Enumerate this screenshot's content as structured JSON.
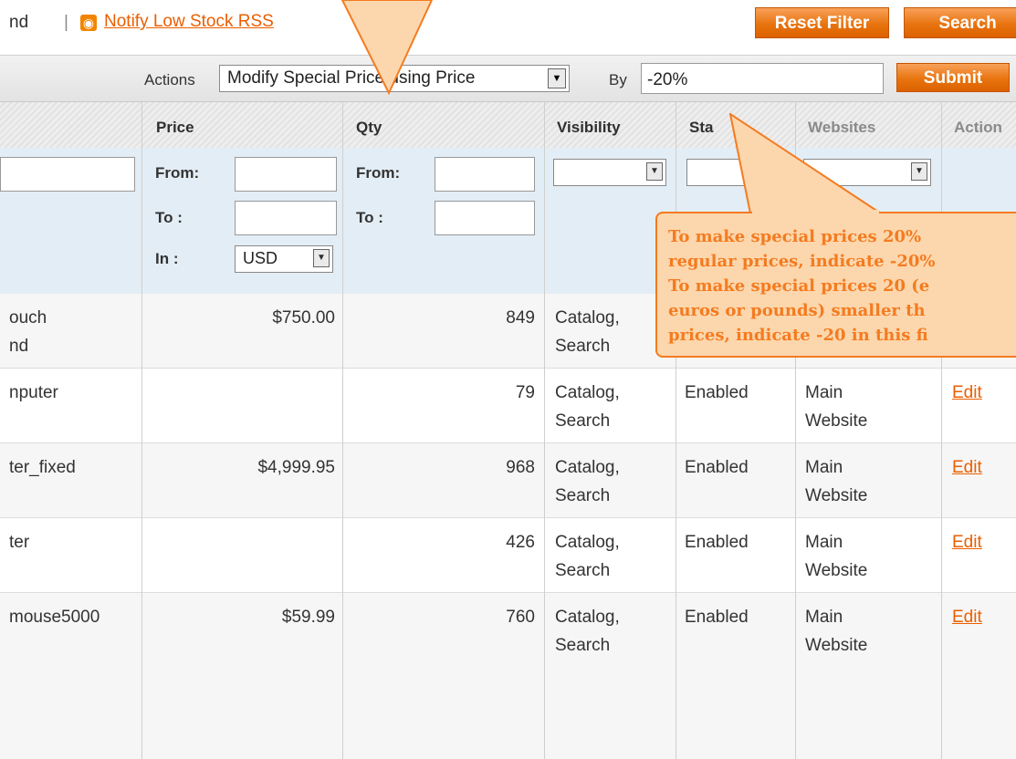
{
  "topbar": {
    "lead_text": "nd",
    "separator": "|",
    "rss_icon": "rss-icon",
    "rss_link": "Notify Low Stock RSS",
    "reset_filter": "Reset Filter",
    "search": "Search"
  },
  "massaction": {
    "actions_label": "Actions",
    "selected_action": "Modify Special Price using Price",
    "by_label": "By",
    "by_value": "-20%",
    "submit": "Submit"
  },
  "columns": {
    "price": "Price",
    "qty": "Qty",
    "visibility": "Visibility",
    "status": "Sta",
    "websites": "Websites",
    "action": "Action"
  },
  "filters": {
    "price_from": "From:",
    "price_to": "To :",
    "price_in": "In :",
    "currency": "USD",
    "qty_from": "From:",
    "qty_to": "To :"
  },
  "rows": [
    {
      "name": [
        "ouch",
        "nd"
      ],
      "price": "$750.00",
      "qty": "849",
      "visibility": [
        "Catalog,",
        "Search"
      ],
      "status": "",
      "website": [
        "",
        ""
      ],
      "action": ""
    },
    {
      "name": [
        "nputer",
        ""
      ],
      "price": "",
      "qty": "79",
      "visibility": [
        "Catalog,",
        "Search"
      ],
      "status": "Enabled",
      "website": [
        "Main",
        "Website"
      ],
      "action": "Edit"
    },
    {
      "name": [
        "ter_fixed",
        ""
      ],
      "price": "$4,999.95",
      "qty": "968",
      "visibility": [
        "Catalog,",
        "Search"
      ],
      "status": "Enabled",
      "website": [
        "Main",
        "Website"
      ],
      "action": "Edit"
    },
    {
      "name": [
        "ter",
        ""
      ],
      "price": "",
      "qty": "426",
      "visibility": [
        "Catalog,",
        "Search"
      ],
      "status": "Enabled",
      "website": [
        "Main",
        "Website"
      ],
      "action": "Edit"
    },
    {
      "name": [
        "mouse5000",
        ""
      ],
      "price": "$59.99",
      "qty": "760",
      "visibility": [
        "Catalog,",
        "Search"
      ],
      "status": "Enabled",
      "website": [
        "Main",
        "Website"
      ],
      "action": "Edit"
    }
  ],
  "tooltip": {
    "lines": [
      "To make special prices 20%",
      "regular prices, indicate -20%",
      "To make special prices 20 (e",
      "euros or pounds) smaller th",
      "prices, indicate -20 in this fi"
    ]
  },
  "colors": {
    "accent": "#eb5e00",
    "callout_fill": "#fcd7ad",
    "callout_stroke": "#f47b20"
  }
}
